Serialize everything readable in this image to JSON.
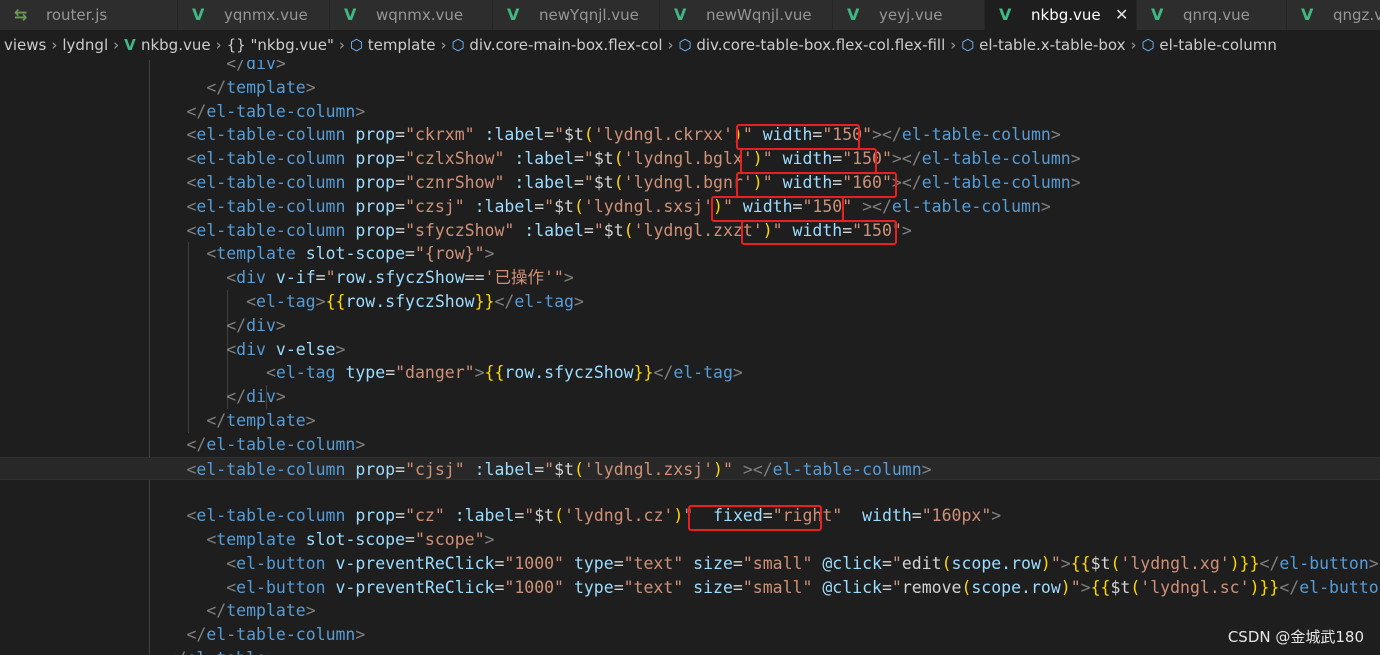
{
  "tabs": [
    {
      "label": "router.js",
      "kind": "js"
    },
    {
      "label": "yqnmx.vue",
      "kind": "vue"
    },
    {
      "label": "wqnmx.vue",
      "kind": "vue"
    },
    {
      "label": "newYqnjl.vue",
      "kind": "vue"
    },
    {
      "label": "newWqnjl.vue",
      "kind": "vue"
    },
    {
      "label": "yeyj.vue",
      "kind": "vue"
    },
    {
      "label": "nkbg.vue",
      "kind": "vue",
      "active": true
    },
    {
      "label": "qnrq.vue",
      "kind": "vue"
    },
    {
      "label": "qngz.vue",
      "kind": "vue"
    }
  ],
  "breadcrumb": [
    {
      "label": "views",
      "icon": ""
    },
    {
      "label": "lydngl",
      "icon": ""
    },
    {
      "label": "nkbg.vue",
      "icon": "vue"
    },
    {
      "label": "\"nkbg.vue\"",
      "icon": "{}"
    },
    {
      "label": "template",
      "icon": "cube"
    },
    {
      "label": "div.core-main-box.flex-col",
      "icon": "cube"
    },
    {
      "label": "div.core-table-box.flex-col.flex-fill",
      "icon": "cube"
    },
    {
      "label": "el-table.x-table-box",
      "icon": "cube"
    },
    {
      "label": "el-table-column",
      "icon": "cube"
    }
  ],
  "code_lines": [
    [
      [
        "            ",
        "k"
      ],
      [
        "</",
        "p"
      ],
      [
        "div",
        "t"
      ],
      [
        ">",
        "p"
      ]
    ],
    [
      [
        "          ",
        "k"
      ],
      [
        "</",
        "p"
      ],
      [
        "template",
        "t"
      ],
      [
        ">",
        "p"
      ]
    ],
    [
      [
        "        ",
        "k"
      ],
      [
        "</",
        "p"
      ],
      [
        "el-table-column",
        "t"
      ],
      [
        ">",
        "p"
      ]
    ],
    [
      [
        "        ",
        "k"
      ],
      [
        "<",
        "p"
      ],
      [
        "el-table-column",
        "t"
      ],
      [
        " ",
        "k"
      ],
      [
        "prop",
        "a"
      ],
      [
        "=",
        "k"
      ],
      [
        "\"ckrxm\"",
        "s"
      ],
      [
        " ",
        "k"
      ],
      [
        ":label",
        "a"
      ],
      [
        "=",
        "k"
      ],
      [
        "\"",
        "s"
      ],
      [
        "$t",
        "k"
      ],
      [
        "(",
        "b"
      ],
      [
        "'lydngl.ckrxx'",
        "s"
      ],
      [
        ")",
        "b"
      ],
      [
        "\"",
        "s"
      ],
      [
        " ",
        "k"
      ],
      [
        "width",
        "a"
      ],
      [
        "=",
        "k"
      ],
      [
        "\"150\"",
        "s"
      ],
      [
        ">",
        "p"
      ],
      [
        "</",
        "p"
      ],
      [
        "el-table-column",
        "t"
      ],
      [
        ">",
        "p"
      ]
    ],
    [
      [
        "        ",
        "k"
      ],
      [
        "<",
        "p"
      ],
      [
        "el-table-column",
        "t"
      ],
      [
        " ",
        "k"
      ],
      [
        "prop",
        "a"
      ],
      [
        "=",
        "k"
      ],
      [
        "\"czlxShow\"",
        "s"
      ],
      [
        " ",
        "k"
      ],
      [
        ":label",
        "a"
      ],
      [
        "=",
        "k"
      ],
      [
        "\"",
        "s"
      ],
      [
        "$t",
        "k"
      ],
      [
        "(",
        "b"
      ],
      [
        "'lydngl.bglx'",
        "s"
      ],
      [
        ")",
        "b"
      ],
      [
        "\"",
        "s"
      ],
      [
        " ",
        "k"
      ],
      [
        "width",
        "a"
      ],
      [
        "=",
        "k"
      ],
      [
        "\"150\"",
        "s"
      ],
      [
        ">",
        "p"
      ],
      [
        "</",
        "p"
      ],
      [
        "el-table-column",
        "t"
      ],
      [
        ">",
        "p"
      ]
    ],
    [
      [
        "        ",
        "k"
      ],
      [
        "<",
        "p"
      ],
      [
        "el-table-column",
        "t"
      ],
      [
        " ",
        "k"
      ],
      [
        "prop",
        "a"
      ],
      [
        "=",
        "k"
      ],
      [
        "\"cznrShow\"",
        "s"
      ],
      [
        " ",
        "k"
      ],
      [
        ":label",
        "a"
      ],
      [
        "=",
        "k"
      ],
      [
        "\"",
        "s"
      ],
      [
        "$t",
        "k"
      ],
      [
        "(",
        "b"
      ],
      [
        "'lydngl.bgnr'",
        "s"
      ],
      [
        ")",
        "b"
      ],
      [
        "\"",
        "s"
      ],
      [
        " ",
        "k"
      ],
      [
        "width",
        "a"
      ],
      [
        "=",
        "k"
      ],
      [
        "\"160\"",
        "s"
      ],
      [
        ">",
        "p"
      ],
      [
        "</",
        "p"
      ],
      [
        "el-table-column",
        "t"
      ],
      [
        ">",
        "p"
      ]
    ],
    [
      [
        "        ",
        "k"
      ],
      [
        "<",
        "p"
      ],
      [
        "el-table-column",
        "t"
      ],
      [
        " ",
        "k"
      ],
      [
        "prop",
        "a"
      ],
      [
        "=",
        "k"
      ],
      [
        "\"czsj\"",
        "s"
      ],
      [
        " ",
        "k"
      ],
      [
        ":label",
        "a"
      ],
      [
        "=",
        "k"
      ],
      [
        "\"",
        "s"
      ],
      [
        "$t",
        "k"
      ],
      [
        "(",
        "b"
      ],
      [
        "'lydngl.sxsj'",
        "s"
      ],
      [
        ")",
        "b"
      ],
      [
        "\"",
        "s"
      ],
      [
        " ",
        "k"
      ],
      [
        "width",
        "a"
      ],
      [
        "=",
        "k"
      ],
      [
        "\"150\"",
        "s"
      ],
      [
        " ",
        "k"
      ],
      [
        ">",
        "p"
      ],
      [
        "</",
        "p"
      ],
      [
        "el-table-column",
        "t"
      ],
      [
        ">",
        "p"
      ]
    ],
    [
      [
        "        ",
        "k"
      ],
      [
        "<",
        "p"
      ],
      [
        "el-table-column",
        "t"
      ],
      [
        " ",
        "k"
      ],
      [
        "prop",
        "a"
      ],
      [
        "=",
        "k"
      ],
      [
        "\"sfyczShow\"",
        "s"
      ],
      [
        " ",
        "k"
      ],
      [
        ":label",
        "a"
      ],
      [
        "=",
        "k"
      ],
      [
        "\"",
        "s"
      ],
      [
        "$t",
        "k"
      ],
      [
        "(",
        "b"
      ],
      [
        "'lydngl.zxzt'",
        "s"
      ],
      [
        ")",
        "b"
      ],
      [
        "\"",
        "s"
      ],
      [
        " ",
        "k"
      ],
      [
        "width",
        "a"
      ],
      [
        "=",
        "k"
      ],
      [
        "\"150\"",
        "s"
      ],
      [
        ">",
        "p"
      ]
    ],
    [
      [
        "          ",
        "k"
      ],
      [
        "<",
        "p"
      ],
      [
        "template",
        "t"
      ],
      [
        " ",
        "k"
      ],
      [
        "slot-scope",
        "a"
      ],
      [
        "=",
        "k"
      ],
      [
        "\"{row}\"",
        "s"
      ],
      [
        ">",
        "p"
      ]
    ],
    [
      [
        "            ",
        "k"
      ],
      [
        "<",
        "p"
      ],
      [
        "div",
        "t"
      ],
      [
        " ",
        "k"
      ],
      [
        "v-if",
        "a"
      ],
      [
        "=",
        "k"
      ],
      [
        "\"",
        "s"
      ],
      [
        "row.sfyczShow",
        "a"
      ],
      [
        "==",
        "k"
      ],
      [
        "'已操作'",
        "s"
      ],
      [
        "\"",
        "s"
      ],
      [
        ">",
        "p"
      ]
    ],
    [
      [
        "              ",
        "k"
      ],
      [
        "<",
        "p"
      ],
      [
        "el-tag",
        "t"
      ],
      [
        ">",
        "p"
      ],
      [
        "{{",
        "b"
      ],
      [
        "row.sfyczShow",
        "a"
      ],
      [
        "}}",
        "b"
      ],
      [
        "</",
        "p"
      ],
      [
        "el-tag",
        "t"
      ],
      [
        ">",
        "p"
      ]
    ],
    [
      [
        "            ",
        "k"
      ],
      [
        "</",
        "p"
      ],
      [
        "div",
        "t"
      ],
      [
        ">",
        "p"
      ]
    ],
    [
      [
        "            ",
        "k"
      ],
      [
        "<",
        "p"
      ],
      [
        "div",
        "t"
      ],
      [
        " ",
        "k"
      ],
      [
        "v-else",
        "a"
      ],
      [
        ">",
        "p"
      ]
    ],
    [
      [
        "                ",
        "k"
      ],
      [
        "<",
        "p"
      ],
      [
        "el-tag",
        "t"
      ],
      [
        " ",
        "k"
      ],
      [
        "type",
        "a"
      ],
      [
        "=",
        "k"
      ],
      [
        "\"danger\"",
        "s"
      ],
      [
        ">",
        "p"
      ],
      [
        "{{",
        "b"
      ],
      [
        "row.sfyczShow",
        "a"
      ],
      [
        "}}",
        "b"
      ],
      [
        "</",
        "p"
      ],
      [
        "el-tag",
        "t"
      ],
      [
        ">",
        "p"
      ]
    ],
    [
      [
        "            ",
        "k"
      ],
      [
        "</",
        "p"
      ],
      [
        "div",
        "t"
      ],
      [
        ">",
        "p"
      ]
    ],
    [
      [
        "          ",
        "k"
      ],
      [
        "</",
        "p"
      ],
      [
        "template",
        "t"
      ],
      [
        ">",
        "p"
      ]
    ],
    [
      [
        "        ",
        "k"
      ],
      [
        "</",
        "p"
      ],
      [
        "el-table-column",
        "t"
      ],
      [
        ">",
        "p"
      ]
    ],
    [
      [
        "        ",
        "k"
      ],
      [
        "<",
        "p"
      ],
      [
        "el-table-column",
        "t"
      ],
      [
        " ",
        "k"
      ],
      [
        "prop",
        "a"
      ],
      [
        "=",
        "k"
      ],
      [
        "\"cjsj\"",
        "s"
      ],
      [
        " ",
        "k"
      ],
      [
        ":label",
        "a"
      ],
      [
        "=",
        "k"
      ],
      [
        "\"",
        "s"
      ],
      [
        "$t",
        "k"
      ],
      [
        "(",
        "b"
      ],
      [
        "'lydngl.zxsj'",
        "s"
      ],
      [
        ")",
        "b"
      ],
      [
        "\"",
        "s"
      ],
      [
        " ",
        "k"
      ],
      [
        ">",
        "p"
      ],
      [
        "</",
        "p"
      ],
      [
        "el-table-column",
        "t"
      ],
      [
        ">",
        "p"
      ]
    ],
    [],
    [
      [
        "        ",
        "k"
      ],
      [
        "<",
        "p"
      ],
      [
        "el-table-column",
        "t"
      ],
      [
        " ",
        "k"
      ],
      [
        "prop",
        "a"
      ],
      [
        "=",
        "k"
      ],
      [
        "\"cz\"",
        "s"
      ],
      [
        " ",
        "k"
      ],
      [
        ":label",
        "a"
      ],
      [
        "=",
        "k"
      ],
      [
        "\"",
        "s"
      ],
      [
        "$t",
        "k"
      ],
      [
        "(",
        "b"
      ],
      [
        "'lydngl.cz'",
        "s"
      ],
      [
        ")",
        "b"
      ],
      [
        "\"",
        "s"
      ],
      [
        "  ",
        "k"
      ],
      [
        "fixed",
        "a"
      ],
      [
        "=",
        "k"
      ],
      [
        "\"right\"",
        "s"
      ],
      [
        "  ",
        "k"
      ],
      [
        "width",
        "a"
      ],
      [
        "=",
        "k"
      ],
      [
        "\"160px\"",
        "s"
      ],
      [
        ">",
        "p"
      ]
    ],
    [
      [
        "          ",
        "k"
      ],
      [
        "<",
        "p"
      ],
      [
        "template",
        "t"
      ],
      [
        " ",
        "k"
      ],
      [
        "slot-scope",
        "a"
      ],
      [
        "=",
        "k"
      ],
      [
        "\"scope\"",
        "s"
      ],
      [
        ">",
        "p"
      ]
    ],
    [
      [
        "            ",
        "k"
      ],
      [
        "<",
        "p"
      ],
      [
        "el-button",
        "t"
      ],
      [
        " ",
        "k"
      ],
      [
        "v-preventReClick",
        "a"
      ],
      [
        "=",
        "k"
      ],
      [
        "\"1000\"",
        "s"
      ],
      [
        " ",
        "k"
      ],
      [
        "type",
        "a"
      ],
      [
        "=",
        "k"
      ],
      [
        "\"text\"",
        "s"
      ],
      [
        " ",
        "k"
      ],
      [
        "size",
        "a"
      ],
      [
        "=",
        "k"
      ],
      [
        "\"small\"",
        "s"
      ],
      [
        " ",
        "k"
      ],
      [
        "@click",
        "a"
      ],
      [
        "=",
        "k"
      ],
      [
        "\"",
        "s"
      ],
      [
        "edit",
        "k"
      ],
      [
        "(",
        "b"
      ],
      [
        "scope.row",
        "a"
      ],
      [
        ")",
        "b"
      ],
      [
        "\"",
        "s"
      ],
      [
        ">",
        "p"
      ],
      [
        "{{",
        "b"
      ],
      [
        "$t",
        "k"
      ],
      [
        "(",
        "b"
      ],
      [
        "'lydngl.xg'",
        "s"
      ],
      [
        ")",
        "b"
      ],
      [
        "}}",
        "b"
      ],
      [
        "</",
        "p"
      ],
      [
        "el-button",
        "t"
      ],
      [
        ">",
        "p"
      ]
    ],
    [
      [
        "            ",
        "k"
      ],
      [
        "<",
        "p"
      ],
      [
        "el-button",
        "t"
      ],
      [
        " ",
        "k"
      ],
      [
        "v-preventReClick",
        "a"
      ],
      [
        "=",
        "k"
      ],
      [
        "\"1000\"",
        "s"
      ],
      [
        " ",
        "k"
      ],
      [
        "type",
        "a"
      ],
      [
        "=",
        "k"
      ],
      [
        "\"text\"",
        "s"
      ],
      [
        " ",
        "k"
      ],
      [
        "size",
        "a"
      ],
      [
        "=",
        "k"
      ],
      [
        "\"small\"",
        "s"
      ],
      [
        " ",
        "k"
      ],
      [
        "@click",
        "a"
      ],
      [
        "=",
        "k"
      ],
      [
        "\"",
        "s"
      ],
      [
        "remove",
        "k"
      ],
      [
        "(",
        "b"
      ],
      [
        "scope.row",
        "a"
      ],
      [
        ")",
        "b"
      ],
      [
        "\"",
        "s"
      ],
      [
        ">",
        "p"
      ],
      [
        "{{",
        "b"
      ],
      [
        "$t",
        "k"
      ],
      [
        "(",
        "b"
      ],
      [
        "'lydngl.sc'",
        "s"
      ],
      [
        ")",
        "b"
      ],
      [
        "}}",
        "b"
      ],
      [
        "</",
        "p"
      ],
      [
        "el-butto",
        "t"
      ]
    ],
    [
      [
        "          ",
        "k"
      ],
      [
        "</",
        "p"
      ],
      [
        "template",
        "t"
      ],
      [
        ">",
        "p"
      ]
    ],
    [
      [
        "        ",
        "k"
      ],
      [
        "</",
        "p"
      ],
      [
        "el-table-column",
        "t"
      ],
      [
        ">",
        "p"
      ]
    ],
    [
      [
        "      ",
        "k"
      ],
      [
        "</",
        "p"
      ],
      [
        "el-table",
        "t"
      ],
      [
        ">",
        "p"
      ]
    ]
  ],
  "watermark": "CSDN @金城武180"
}
